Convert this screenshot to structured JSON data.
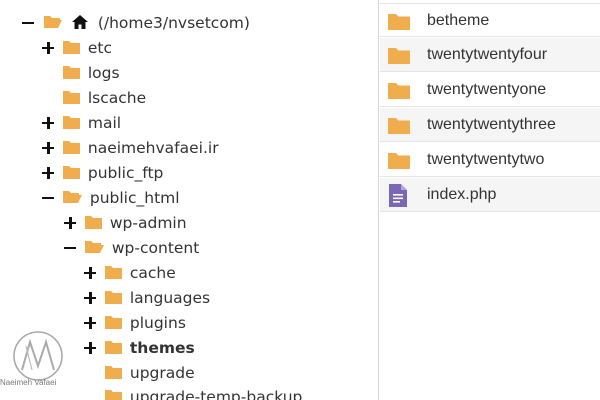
{
  "tree": {
    "root_label": "(/home3/nvsetcom)",
    "items": [
      {
        "label": "etc",
        "toggle": "plus"
      },
      {
        "label": "logs",
        "toggle": "none"
      },
      {
        "label": "lscache",
        "toggle": "none"
      },
      {
        "label": "mail",
        "toggle": "plus"
      },
      {
        "label": "naeimehvafaei.ir",
        "toggle": "plus"
      },
      {
        "label": "public_ftp",
        "toggle": "plus"
      },
      {
        "label": "public_html",
        "toggle": "minus"
      },
      {
        "label": "wp-admin",
        "toggle": "plus"
      },
      {
        "label": "wp-content",
        "toggle": "minus"
      },
      {
        "label": "cache",
        "toggle": "plus"
      },
      {
        "label": "languages",
        "toggle": "plus"
      },
      {
        "label": "plugins",
        "toggle": "plus"
      },
      {
        "label": "themes",
        "toggle": "plus",
        "selected": true
      },
      {
        "label": "upgrade",
        "toggle": "none"
      },
      {
        "label": "upgrade-temp-backup",
        "toggle": "none"
      }
    ]
  },
  "files": [
    {
      "name": "betheme",
      "type": "folder"
    },
    {
      "name": "twentytwentyfour",
      "type": "folder"
    },
    {
      "name": "twentytwentyone",
      "type": "folder"
    },
    {
      "name": "twentytwentythree",
      "type": "folder"
    },
    {
      "name": "twentytwentytwo",
      "type": "folder"
    },
    {
      "name": "index.php",
      "type": "file"
    }
  ],
  "watermark": {
    "caption": "Naeimeh Vafaei"
  },
  "colors": {
    "folder": "#f0ad4e",
    "file_icon": "#7b68b5",
    "row_alt": "#f5f5f5"
  }
}
